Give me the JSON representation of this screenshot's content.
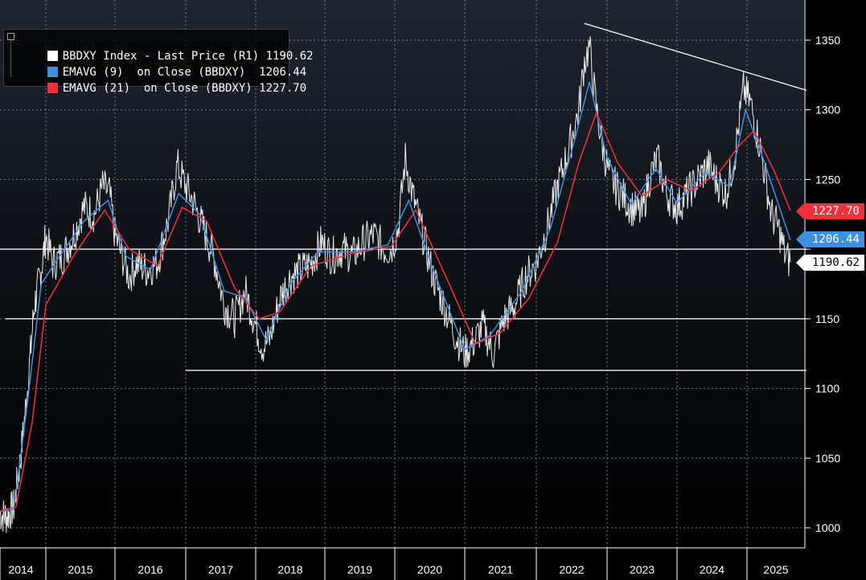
{
  "chart_data": {
    "type": "line",
    "x_labels": [
      "2014",
      "2015",
      "2016",
      "2017",
      "2018",
      "2019",
      "2020",
      "2021",
      "2022",
      "2023",
      "2024",
      "2025"
    ],
    "yticks": [
      1000,
      1050,
      1100,
      1150,
      1200,
      1250,
      1300,
      1350
    ],
    "ytick_labels": [
      "1000",
      "1050",
      "1100",
      "1150",
      "",
      "1250",
      "1300",
      "1350"
    ],
    "ylim": [
      980,
      1375
    ],
    "xlim": [
      2014.0,
      2025.7
    ],
    "axis_side": "right",
    "grid": true,
    "legend_position": "top-left",
    "series": [
      {
        "name": "BBDXY Index - Last Price (R1)",
        "last": "1190.62",
        "color": "#ffffff",
        "points": [
          [
            2014.0,
            1010
          ],
          [
            2014.15,
            1008
          ],
          [
            2014.3,
            1015
          ],
          [
            2014.45,
            1050
          ],
          [
            2014.6,
            1100
          ],
          [
            2014.75,
            1160
          ],
          [
            2014.9,
            1185
          ],
          [
            2015.0,
            1210
          ],
          [
            2015.1,
            1190
          ],
          [
            2015.25,
            1195
          ],
          [
            2015.4,
            1210
          ],
          [
            2015.55,
            1230
          ],
          [
            2015.7,
            1225
          ],
          [
            2015.82,
            1245
          ],
          [
            2015.92,
            1240
          ],
          [
            2016.0,
            1210
          ],
          [
            2016.1,
            1195
          ],
          [
            2016.2,
            1180
          ],
          [
            2016.3,
            1190
          ],
          [
            2016.45,
            1185
          ],
          [
            2016.6,
            1190
          ],
          [
            2016.75,
            1220
          ],
          [
            2016.88,
            1260
          ],
          [
            2017.0,
            1245
          ],
          [
            2017.1,
            1235
          ],
          [
            2017.25,
            1215
          ],
          [
            2017.4,
            1195
          ],
          [
            2017.55,
            1160
          ],
          [
            2017.7,
            1150
          ],
          [
            2017.85,
            1170
          ],
          [
            2018.0,
            1145
          ],
          [
            2018.1,
            1130
          ],
          [
            2018.2,
            1135
          ],
          [
            2018.35,
            1165
          ],
          [
            2018.5,
            1180
          ],
          [
            2018.65,
            1185
          ],
          [
            2018.8,
            1190
          ],
          [
            2018.95,
            1205
          ],
          [
            2019.1,
            1195
          ],
          [
            2019.25,
            1200
          ],
          [
            2019.4,
            1195
          ],
          [
            2019.55,
            1205
          ],
          [
            2019.7,
            1210
          ],
          [
            2019.85,
            1200
          ],
          [
            2019.95,
            1200
          ],
          [
            2020.05,
            1215
          ],
          [
            2020.15,
            1265
          ],
          [
            2020.25,
            1240
          ],
          [
            2020.4,
            1210
          ],
          [
            2020.55,
            1180
          ],
          [
            2020.7,
            1160
          ],
          [
            2020.85,
            1140
          ],
          [
            2021.0,
            1125
          ],
          [
            2021.15,
            1135
          ],
          [
            2021.25,
            1145
          ],
          [
            2021.4,
            1125
          ],
          [
            2021.55,
            1150
          ],
          [
            2021.7,
            1160
          ],
          [
            2021.85,
            1180
          ],
          [
            2022.0,
            1190
          ],
          [
            2022.15,
            1215
          ],
          [
            2022.3,
            1245
          ],
          [
            2022.45,
            1270
          ],
          [
            2022.6,
            1300
          ],
          [
            2022.68,
            1335
          ],
          [
            2022.75,
            1345
          ],
          [
            2022.85,
            1300
          ],
          [
            2022.95,
            1270
          ],
          [
            2023.05,
            1250
          ],
          [
            2023.2,
            1240
          ],
          [
            2023.35,
            1230
          ],
          [
            2023.5,
            1225
          ],
          [
            2023.6,
            1250
          ],
          [
            2023.72,
            1265
          ],
          [
            2023.85,
            1240
          ],
          [
            2024.0,
            1230
          ],
          [
            2024.15,
            1240
          ],
          [
            2024.3,
            1250
          ],
          [
            2024.45,
            1260
          ],
          [
            2024.55,
            1250
          ],
          [
            2024.7,
            1240
          ],
          [
            2024.82,
            1265
          ],
          [
            2024.95,
            1315
          ],
          [
            2025.05,
            1305
          ],
          [
            2025.2,
            1270
          ],
          [
            2025.35,
            1225
          ],
          [
            2025.45,
            1215
          ],
          [
            2025.55,
            1195
          ],
          [
            2025.62,
            1190.62
          ]
        ]
      },
      {
        "name": "EMAVG (9)  on Close (BBDXY)",
        "last": "1206.44",
        "color": "#3d8fe0",
        "points": [
          [
            2014.0,
            1012
          ],
          [
            2014.3,
            1013
          ],
          [
            2014.6,
            1090
          ],
          [
            2014.9,
            1175
          ],
          [
            2015.2,
            1195
          ],
          [
            2015.55,
            1220
          ],
          [
            2015.9,
            1235
          ],
          [
            2016.15,
            1195
          ],
          [
            2016.5,
            1185
          ],
          [
            2016.9,
            1240
          ],
          [
            2017.2,
            1225
          ],
          [
            2017.55,
            1170
          ],
          [
            2017.85,
            1165
          ],
          [
            2018.15,
            1135
          ],
          [
            2018.5,
            1175
          ],
          [
            2018.9,
            1198
          ],
          [
            2019.4,
            1198
          ],
          [
            2019.9,
            1203
          ],
          [
            2020.2,
            1235
          ],
          [
            2020.55,
            1185
          ],
          [
            2021.0,
            1128
          ],
          [
            2021.35,
            1138
          ],
          [
            2021.8,
            1170
          ],
          [
            2022.2,
            1215
          ],
          [
            2022.55,
            1280
          ],
          [
            2022.75,
            1320
          ],
          [
            2023.0,
            1265
          ],
          [
            2023.35,
            1232
          ],
          [
            2023.7,
            1258
          ],
          [
            2024.0,
            1233
          ],
          [
            2024.4,
            1255
          ],
          [
            2024.75,
            1245
          ],
          [
            2024.98,
            1300
          ],
          [
            2025.25,
            1262
          ],
          [
            2025.62,
            1206.44
          ]
        ]
      },
      {
        "name": "EMAVG (21)  on Close (BBDXY)",
        "last": "1227.70",
        "color": "#f0303c",
        "points": [
          [
            2014.0,
            1012
          ],
          [
            2014.35,
            1015
          ],
          [
            2014.7,
            1075
          ],
          [
            2015.0,
            1160
          ],
          [
            2015.4,
            1195
          ],
          [
            2015.85,
            1228
          ],
          [
            2016.2,
            1200
          ],
          [
            2016.6,
            1188
          ],
          [
            2016.95,
            1230
          ],
          [
            2017.3,
            1220
          ],
          [
            2017.7,
            1172
          ],
          [
            2018.05,
            1150
          ],
          [
            2018.35,
            1155
          ],
          [
            2018.8,
            1188
          ],
          [
            2019.4,
            1197
          ],
          [
            2019.95,
            1202
          ],
          [
            2020.3,
            1228
          ],
          [
            2020.75,
            1178
          ],
          [
            2021.15,
            1132
          ],
          [
            2021.5,
            1140
          ],
          [
            2021.9,
            1165
          ],
          [
            2022.3,
            1205
          ],
          [
            2022.6,
            1262
          ],
          [
            2022.85,
            1298
          ],
          [
            2023.15,
            1262
          ],
          [
            2023.5,
            1238
          ],
          [
            2023.85,
            1250
          ],
          [
            2024.2,
            1242
          ],
          [
            2024.6,
            1255
          ],
          [
            2024.9,
            1275
          ],
          [
            2025.1,
            1285
          ],
          [
            2025.4,
            1255
          ],
          [
            2025.62,
            1227.7
          ]
        ]
      }
    ],
    "annotations": [
      {
        "kind": "trendline",
        "from": [
          2022.68,
          1362
        ],
        "to": [
          2025.85,
          1314
        ]
      },
      {
        "kind": "hline",
        "y": 1200,
        "x_from": 2014.0,
        "x_to": 2025.85
      },
      {
        "kind": "hline",
        "y": 1150,
        "x_from": 2014.12,
        "x_to": 2025.85
      },
      {
        "kind": "hline",
        "y": 1113,
        "x_from": 2017.0,
        "x_to": 2025.85
      }
    ]
  },
  "legend": {
    "items": [
      {
        "label": "BBDXY Index - Last Price (R1) 1190.62",
        "color": "#ffffff"
      },
      {
        "label": "EMAVG (9)  on Close (BBDXY)  1206.44",
        "color": "#3d8fe0"
      },
      {
        "label": "EMAVG (21)  on Close (BBDXY) 1227.70",
        "color": "#f0303c"
      }
    ]
  },
  "price_tags": {
    "ema21": "1227.70",
    "ema9": "1206.44",
    "last": "1190.62"
  },
  "colors": {
    "background_top": "#1e2530",
    "background_bottom": "#000000",
    "grid": "#8a9099",
    "axis_text": "#ffffff"
  }
}
